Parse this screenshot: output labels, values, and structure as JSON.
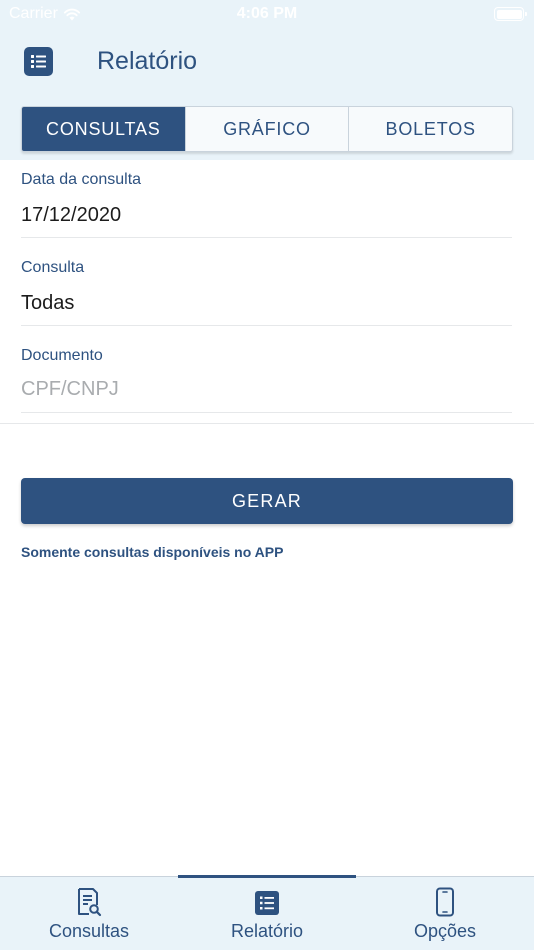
{
  "status_bar": {
    "carrier": "Carrier",
    "time": "4:06 PM"
  },
  "header": {
    "title": "Relatório",
    "menu_icon": "list-icon"
  },
  "segments": [
    {
      "label": "CONSULTAS",
      "active": true
    },
    {
      "label": "GRÁFICO",
      "active": false
    },
    {
      "label": "BOLETOS",
      "active": false
    }
  ],
  "form": {
    "date": {
      "label": "Data da consulta",
      "value": "17/12/2020"
    },
    "query": {
      "label": "Consulta",
      "value": "Todas"
    },
    "document": {
      "label": "Documento",
      "placeholder": "CPF/CNPJ",
      "value": ""
    }
  },
  "generate_button": "GERAR",
  "note": "Somente consultas disponíveis no APP",
  "tab_bar": [
    {
      "label": "Consultas",
      "icon": "document-search-icon",
      "active": false
    },
    {
      "label": "Relatório",
      "icon": "list-icon",
      "active": true
    },
    {
      "label": "Opções",
      "icon": "phone-icon",
      "active": false
    }
  ],
  "colors": {
    "primary": "#2e5280",
    "background_tint": "#e9f3f9",
    "placeholder": "#a9acaf"
  }
}
